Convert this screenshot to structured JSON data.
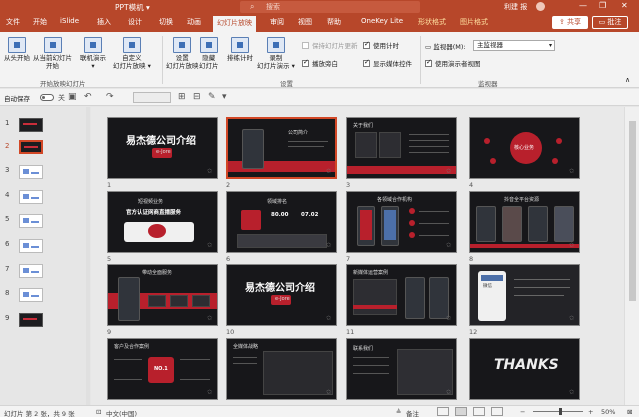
{
  "window": {
    "title": "PPT模机 ▾",
    "search_placeholder": "搜索",
    "user": "利建 报",
    "minimize": "—",
    "restore": "❐",
    "close": "✕"
  },
  "tabs": [
    {
      "label": "文件",
      "active": false
    },
    {
      "label": "开始",
      "active": false
    },
    {
      "label": "iSlide",
      "active": false
    },
    {
      "label": "插入",
      "active": false
    },
    {
      "label": "设计",
      "active": false
    },
    {
      "label": "切换",
      "active": false
    },
    {
      "label": "动画",
      "active": false
    },
    {
      "label": "幻灯片放映",
      "active": true
    },
    {
      "label": "审阅",
      "active": false
    },
    {
      "label": "视图",
      "active": false
    },
    {
      "label": "帮助",
      "active": false
    },
    {
      "label": "OneKey Lite",
      "active": false
    },
    {
      "label": "形状格式",
      "active": false
    },
    {
      "label": "图片格式",
      "active": false
    }
  ],
  "actions": {
    "share": "共享",
    "comments": "批注"
  },
  "ribbon": {
    "buttons": [
      {
        "label": "从头开始",
        "sub": ""
      },
      {
        "label": "从当前幻灯片",
        "sub": "开始"
      },
      {
        "label": "联机演示",
        "sub": "▾"
      },
      {
        "label": "自定义",
        "sub": "幻灯片放映 ▾"
      },
      {
        "label": "设置",
        "sub": "幻灯片放映"
      },
      {
        "label": "隐藏",
        "sub": "幻灯片"
      },
      {
        "label": "排练计时",
        "sub": ""
      },
      {
        "label": "录制",
        "sub": "幻灯片演示 ▾"
      }
    ],
    "checkboxes": [
      {
        "label": "保持幻灯片更新",
        "checked": false,
        "disabled": true
      },
      {
        "label": "使用计时",
        "checked": true,
        "disabled": false
      },
      {
        "label": "播放旁白",
        "checked": true,
        "disabled": false
      },
      {
        "label": "显示媒体控件",
        "checked": true,
        "disabled": false
      },
      {
        "label": "使用演示者视图",
        "checked": true,
        "disabled": false
      }
    ],
    "monitor_label": "监视器(M):",
    "monitor_value": "主监视器",
    "groups": [
      "开始放映幻灯片",
      "设置",
      "监视器"
    ]
  },
  "qat": {
    "autosave_label": "自动保存",
    "autosave_state": "关"
  },
  "thumbnails": [
    {
      "num": "1",
      "theme": "dark",
      "selected": false
    },
    {
      "num": "2",
      "theme": "dark",
      "selected": true
    },
    {
      "num": "3",
      "theme": "light",
      "selected": false
    },
    {
      "num": "4",
      "theme": "light",
      "selected": false
    },
    {
      "num": "5",
      "theme": "light",
      "selected": false
    },
    {
      "num": "6",
      "theme": "light",
      "selected": false
    },
    {
      "num": "7",
      "theme": "light",
      "selected": false
    },
    {
      "num": "8",
      "theme": "light",
      "selected": false
    },
    {
      "num": "9",
      "theme": "dark",
      "selected": false
    }
  ],
  "slides": {
    "s1": {
      "num": "1",
      "title": "易杰德公司介绍",
      "sub": "e-Jore"
    },
    "s2": {
      "num": "2",
      "title": "公司简介"
    },
    "s3": {
      "num": "3",
      "title": "关于我们"
    },
    "s4": {
      "num": "4",
      "title": "核心业务"
    },
    "s5": {
      "num": "5",
      "title": "短视频业务",
      "sub": "官方认证网商直播服务"
    },
    "s6": {
      "num": "6",
      "title": "领域排名",
      "v1": "80.00",
      "v2": "07.02"
    },
    "s7": {
      "num": "7",
      "title": "各领域合作机构"
    },
    "s8": {
      "num": "8",
      "title": "抖音全平台资源"
    },
    "s9": {
      "num": "9",
      "title": "带动全面服务"
    },
    "s10": {
      "num": "10",
      "title": "易杰德公司介绍",
      "sub": "e-Jore"
    },
    "s11": {
      "num": "11",
      "title": "新媒体运营案例"
    },
    "s12": {
      "num": "12",
      "title": "微信"
    },
    "s13": {
      "num": "13",
      "title": "客户及合作案例",
      "badge": "NO.1"
    },
    "s14": {
      "num": "14",
      "title": "全媒体战略"
    },
    "s15": {
      "num": "15",
      "title": "联系我们"
    },
    "s16": {
      "num": "16",
      "title": "THANKS"
    }
  },
  "status": {
    "slide_info": "幻灯片 第 2 张，共 9 张",
    "language": "中文(中国)",
    "notes": "备注",
    "zoom": "50%"
  }
}
